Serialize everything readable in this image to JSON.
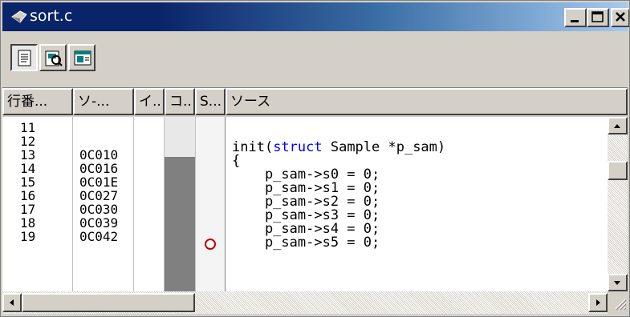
{
  "window": {
    "title": "sort.c"
  },
  "toolbar": {
    "buttons": [
      "source-view-icon",
      "disassembly-view-icon",
      "mixed-view-icon"
    ]
  },
  "columns": [
    "行番...",
    "ソ-...",
    "イ..",
    "コ..",
    "S...",
    "ソース"
  ],
  "rows": [
    {
      "line": "11",
      "address": ""
    },
    {
      "line": "12",
      "address": ""
    },
    {
      "line": "13",
      "address": "0C010"
    },
    {
      "line": "14",
      "address": "0C016"
    },
    {
      "line": "15",
      "address": "0C01E"
    },
    {
      "line": "16",
      "address": "0C027"
    },
    {
      "line": "17",
      "address": "0C030"
    },
    {
      "line": "18",
      "address": "0C039"
    },
    {
      "line": "19",
      "address": "0C042"
    }
  ],
  "source": {
    "line12_func": "init(",
    "line12_kw": "struct",
    "line12_rest": " Sample *p_sam)",
    "line13": "{",
    "line14": "    p_sam->s0 = 0;",
    "line15": "    p_sam->s1 = 0;",
    "line16": "    p_sam->s2 = 0;",
    "line17": "    p_sam->s3 = 0;",
    "line18": "    p_sam->s4 = 0;",
    "line19": "    p_sam->s5 = 0;"
  },
  "colors": {
    "keyword": "#0000ff",
    "breakpoint": "#c00000",
    "coverage": "#808080"
  }
}
